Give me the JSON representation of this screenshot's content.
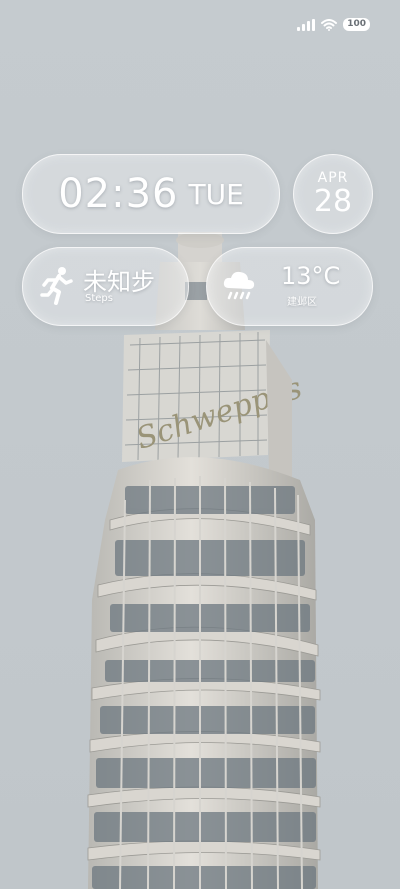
{
  "status_bar": {
    "battery": "100",
    "icons": [
      "signal-icon",
      "wifi-icon",
      "battery-icon"
    ]
  },
  "clock": {
    "time": "02:36",
    "day": "TUE"
  },
  "date": {
    "month": "APR",
    "day": "28"
  },
  "steps": {
    "value": "未知步",
    "label": "Steps",
    "icon": "running-person-icon"
  },
  "weather": {
    "temperature": "13°C",
    "location": "建邺区",
    "icon": "rain-cloud-icon"
  },
  "wallpaper": {
    "sign_text": "Schweppes"
  }
}
